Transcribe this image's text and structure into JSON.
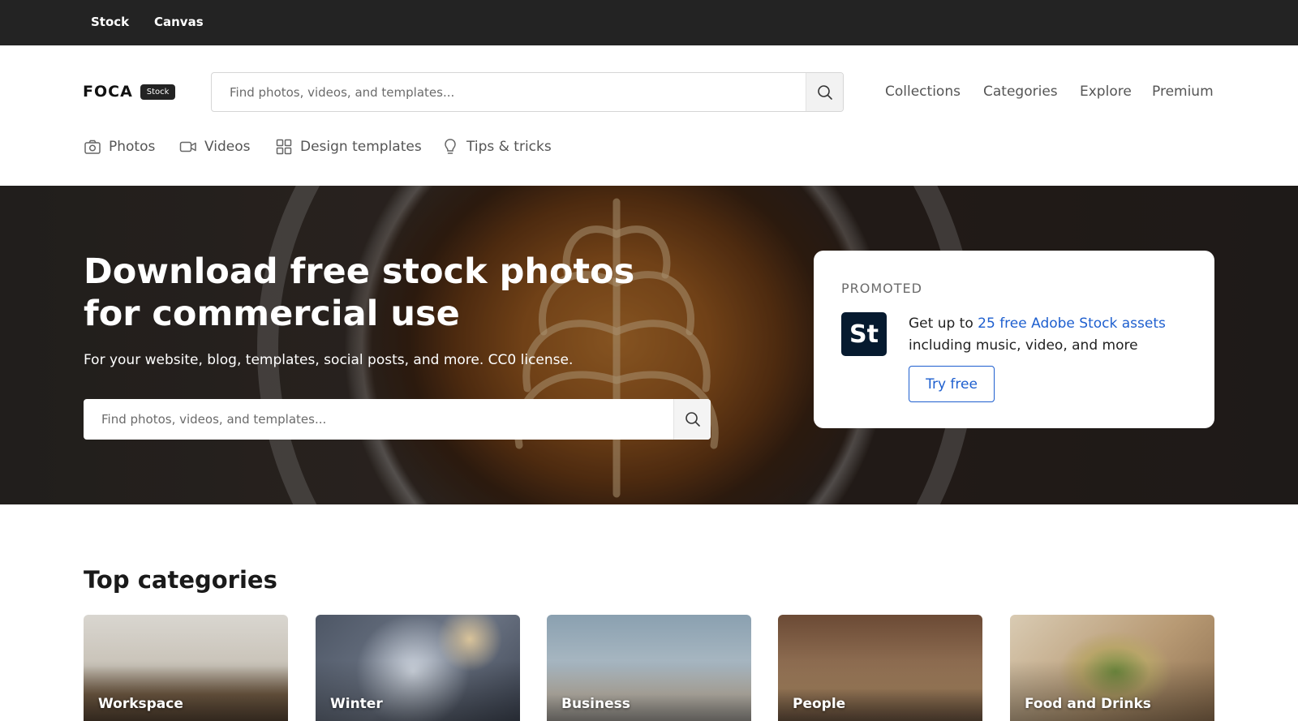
{
  "topbar": {
    "links": [
      "Stock",
      "Canvas"
    ]
  },
  "header": {
    "logo_text": "FOCA",
    "logo_badge": "Stock",
    "search_placeholder": "Find photos, videos, and templates...",
    "nav": [
      "Collections",
      "Categories",
      "Explore",
      "Premium"
    ],
    "subnav": [
      {
        "label": "Photos",
        "icon": "camera-icon"
      },
      {
        "label": "Videos",
        "icon": "video-icon"
      },
      {
        "label": "Design templates",
        "icon": "grid-icon"
      },
      {
        "label": "Tips & tricks",
        "icon": "lightbulb-icon"
      }
    ]
  },
  "hero": {
    "title": "Download free stock photos for commercial use",
    "subtitle": "For your website, blog, templates, social posts, and more. CC0 license.",
    "search_placeholder": "Find photos, videos, and templates..."
  },
  "promo": {
    "label": "PROMOTED",
    "logo_text": "St",
    "text_prefix": "Get up to ",
    "link_text": "25 free Adobe Stock assets",
    "text_suffix": "including music, video, and more",
    "button_label": "Try free",
    "link_color": "#1e5fcf"
  },
  "categories": {
    "title": "Top categories",
    "items": [
      "Workspace",
      "Winter",
      "Business",
      "People",
      "Food and Drinks"
    ]
  }
}
